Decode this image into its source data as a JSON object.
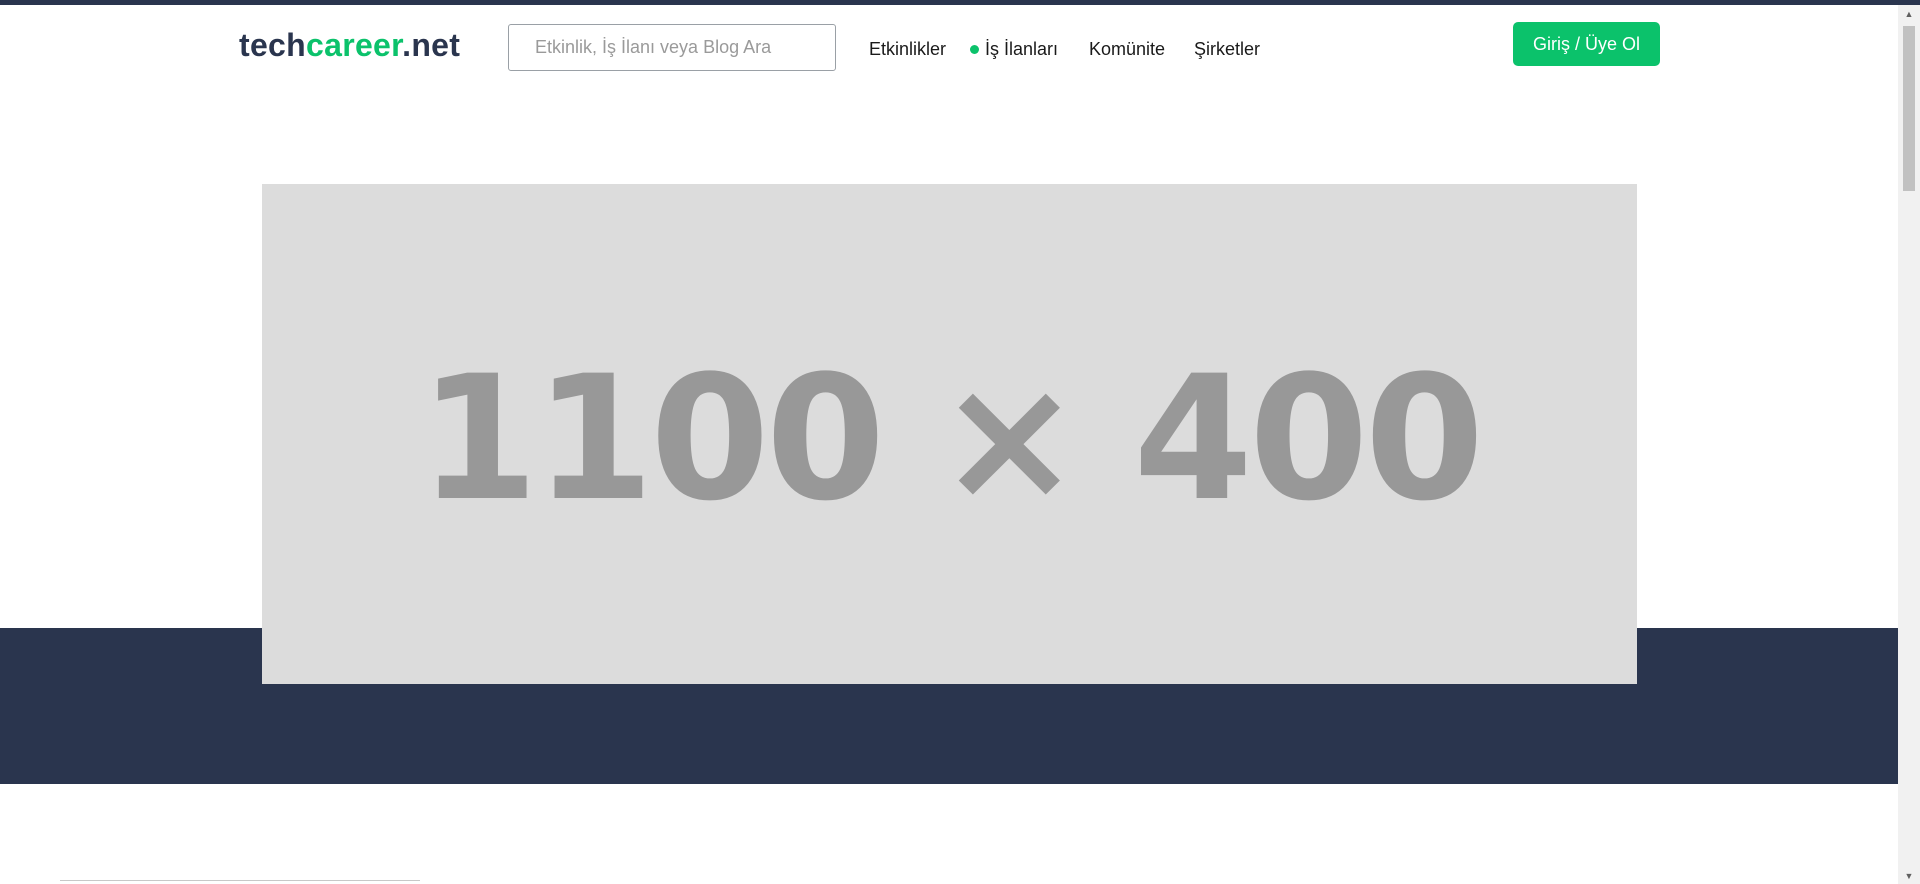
{
  "header": {
    "logo": {
      "part_a": "tech",
      "part_b": "career",
      "part_c": ".net"
    },
    "search": {
      "placeholder": "Etkinlik, İş İlanı veya Blog Ara"
    },
    "nav": {
      "events": "Etkinlikler",
      "jobs": "İş İlanları",
      "community": "Komünite",
      "companies": "Şirketler"
    },
    "login_label": "Giriş / Üye Ol"
  },
  "hero": {
    "placeholder_text": "1100 × 400"
  },
  "colors": {
    "brand_dark": "#2a354e",
    "brand_green": "#0bc26b",
    "placeholder_bg": "#dcdcdc",
    "placeholder_text": "#989898"
  },
  "icons": {
    "jobs_indicator": "green-dot-icon",
    "scroll_up": "triangle-up-icon",
    "scroll_down": "triangle-down-icon"
  }
}
